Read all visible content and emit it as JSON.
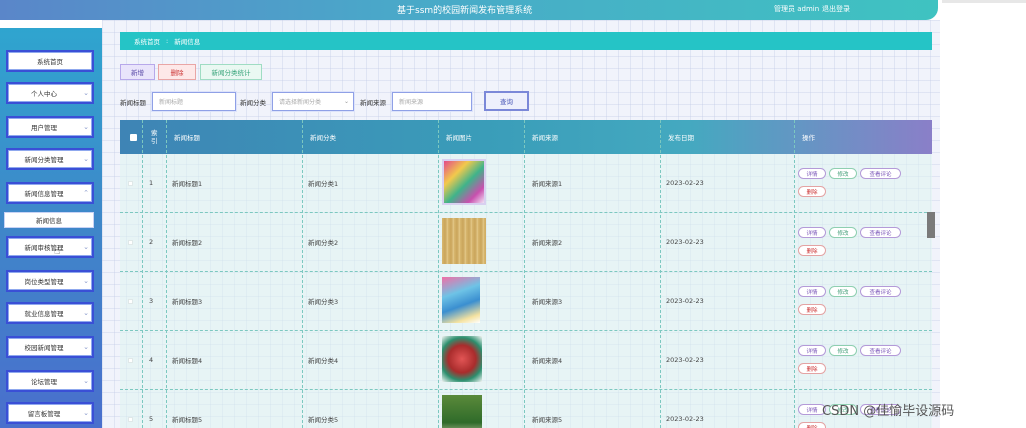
{
  "header": {
    "title": "基于ssm的校园新闻发布管理系统",
    "user": "管理员 admin",
    "logout": "退出登录"
  },
  "sidebar": {
    "items": [
      {
        "label": "系统首页",
        "chevron": ""
      },
      {
        "label": "个人中心",
        "chevron": "⌄"
      },
      {
        "label": "用户管理",
        "chevron": "⌄"
      },
      {
        "label": "新闻分类管理",
        "chevron": "⌄"
      },
      {
        "label": "新闻信息管理",
        "chevron": "⌃"
      },
      {
        "label": "新闻审核管理",
        "chevron": "⌄"
      },
      {
        "label": "岗位类型管理",
        "chevron": "⌄"
      },
      {
        "label": "就业信息管理",
        "chevron": "⌄"
      },
      {
        "label": "校园新闻管理",
        "chevron": "⌄"
      },
      {
        "label": "论坛管理",
        "chevron": "⌄"
      },
      {
        "label": "留言板管理",
        "chevron": "⌄"
      }
    ],
    "sub_item": "新闻信息"
  },
  "breadcrumb": {
    "home": "系统首页",
    "sep": ":",
    "current": "新闻信息"
  },
  "toolbar": {
    "add": "新增",
    "delete": "删除",
    "stats": "新闻分类统计"
  },
  "filters": {
    "title_label": "新闻标题",
    "title_placeholder": "新闻标题",
    "category_label": "新闻分类",
    "category_placeholder": "请选择新闻分类",
    "source_label": "新闻来源",
    "source_placeholder": "新闻来源",
    "search": "查询"
  },
  "table": {
    "headers": {
      "index": "索引",
      "title": "新闻标题",
      "category": "新闻分类",
      "image": "新闻图片",
      "source": "新闻来源",
      "date": "发布日期",
      "actions": "操作"
    },
    "rows": [
      {
        "index": "1",
        "title": "新闻标题1",
        "category": "新闻分类1",
        "source": "新闻来源1",
        "date": "2023-02-23"
      },
      {
        "index": "2",
        "title": "新闻标题2",
        "category": "新闻分类2",
        "source": "新闻来源2",
        "date": "2023-02-23"
      },
      {
        "index": "3",
        "title": "新闻标题3",
        "category": "新闻分类3",
        "source": "新闻来源3",
        "date": "2023-02-23"
      },
      {
        "index": "4",
        "title": "新闻标题4",
        "category": "新闻分类4",
        "source": "新闻来源4",
        "date": "2023-02-23"
      },
      {
        "index": "5",
        "title": "新闻标题5",
        "category": "新闻分类5",
        "source": "新闻来源5",
        "date": "2023-02-23"
      }
    ],
    "actions": {
      "detail": "详情",
      "edit": "修改",
      "review": "查看评论",
      "remove": "删除"
    }
  },
  "colors": {
    "header_start": "#5a86c9",
    "header_end": "#3fc3c1",
    "breadcrumb": "#25c4c6",
    "sidebar_border": "#3a4fd6"
  },
  "watermark": "CSDN @佳愉毕设源码"
}
